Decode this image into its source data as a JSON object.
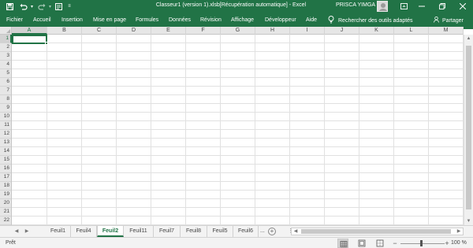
{
  "window": {
    "title": "Classeur1 (version 1).xlsb[Récupération automatique]  -  Excel",
    "user_name": "PRISCA YIMGA"
  },
  "quick_access": {
    "save_icon": "save-icon",
    "undo_icon": "undo-icon",
    "redo_icon": "redo-icon",
    "customize_icon": "customize-icon"
  },
  "ribbon": {
    "tabs": [
      "Fichier",
      "Accueil",
      "Insertion",
      "Mise en page",
      "Formules",
      "Données",
      "Révision",
      "Affichage",
      "Développeur",
      "Aide"
    ],
    "tell_me": "Rechercher des outils adaptés",
    "share": "Partager"
  },
  "grid": {
    "columns": [
      "A",
      "B",
      "C",
      "D",
      "E",
      "F",
      "G",
      "H",
      "I",
      "J",
      "K",
      "L",
      "M"
    ],
    "rows": [
      "1",
      "2",
      "3",
      "4",
      "5",
      "6",
      "7",
      "8",
      "9",
      "10",
      "11",
      "12",
      "13",
      "14",
      "15",
      "16",
      "17",
      "18",
      "19",
      "20",
      "21",
      "22"
    ],
    "active_cell": "A1"
  },
  "sheets": {
    "tabs": [
      "Feuil1",
      "Feuil4",
      "Feuil2",
      "Feuil11",
      "Feuil7",
      "Feuil8",
      "Feuil5",
      "Feuil6"
    ],
    "active": "Feuil2",
    "more": "...",
    "add": "+"
  },
  "status": {
    "ready": "Prêt",
    "zoom": "100 %",
    "zoom_percent": 100
  },
  "colors": {
    "accent": "#217346",
    "grid_line": "#e1e1e1",
    "header_bg": "#e6e6e6"
  }
}
